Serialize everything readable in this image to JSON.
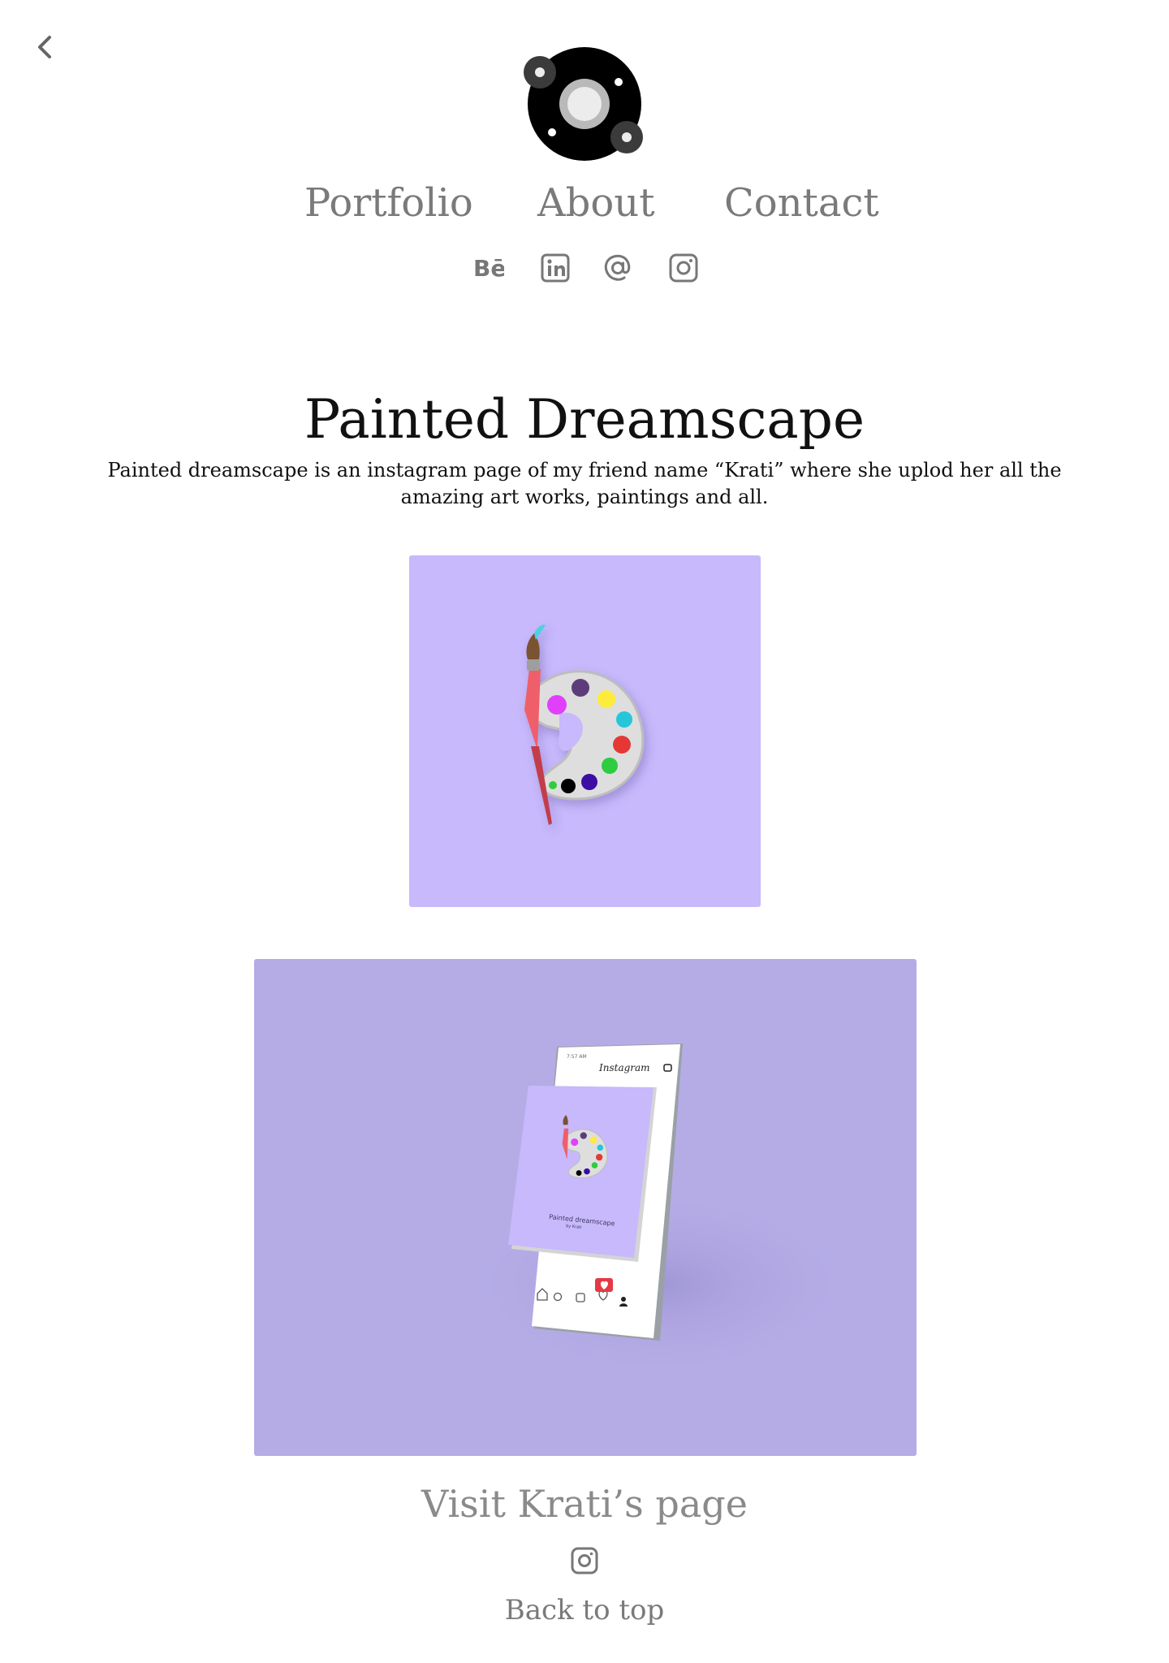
{
  "nav": {
    "back_icon": "chevron-left-icon",
    "items": [
      {
        "label": "Portfolio"
      },
      {
        "label": "About"
      },
      {
        "label": "Contact"
      }
    ],
    "social_icons": [
      "behance-icon",
      "linkedin-icon",
      "email-at-icon",
      "instagram-icon"
    ]
  },
  "project": {
    "title": "Painted Dreamscape",
    "description": "Painted dreamscape is an instagram page of my friend name “Krati” where she uplod her all the amazing art works, paintings  and all."
  },
  "mockup": {
    "app_name": "Instagram",
    "time": "7:57 AM",
    "post_title": "Painted dreamscape",
    "post_subtitle": "by Krati"
  },
  "footer": {
    "visit_label": "Visit Krati’s page",
    "visit_icon": "instagram-icon",
    "back_to_top": "Back to top"
  },
  "colors": {
    "nav_text": "#7a7a7a",
    "image_bg_1": "#c7b9fb",
    "image_bg_2": "#b5ace6"
  }
}
